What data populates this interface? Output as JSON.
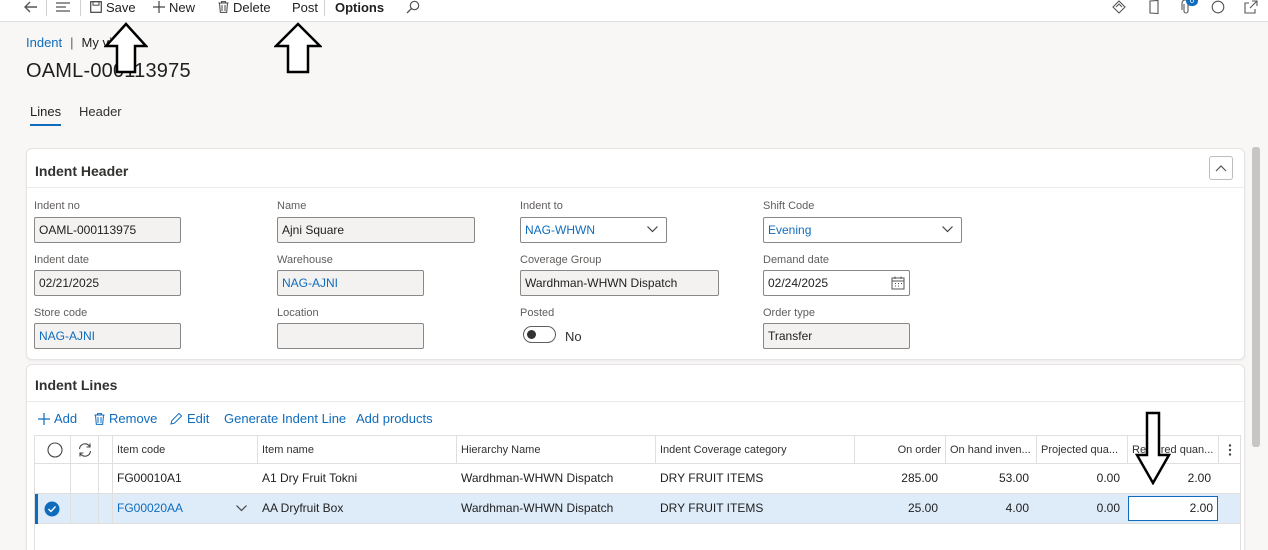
{
  "toolbar": {
    "save_label": "Save",
    "new_label": "New",
    "delete_label": "Delete",
    "post_label": "Post",
    "options_label": "Options",
    "notification_count": "0"
  },
  "breadcrumb": {
    "link": "Indent",
    "separator": "|",
    "view": "My view"
  },
  "page_title": "OAML-000113975",
  "tabs": [
    {
      "label": "Lines",
      "active": true
    },
    {
      "label": "Header",
      "active": false
    }
  ],
  "indent_header": {
    "title": "Indent Header",
    "fields": {
      "indent_no": {
        "label": "Indent no",
        "value": "OAML-000113975"
      },
      "name": {
        "label": "Name",
        "value": "Ajni Square"
      },
      "indent_to": {
        "label": "Indent to",
        "value": "NAG-WHWN"
      },
      "shift_code": {
        "label": "Shift Code",
        "value": "Evening"
      },
      "indent_date": {
        "label": "Indent date",
        "value": "02/21/2025"
      },
      "warehouse": {
        "label": "Warehouse",
        "value": "NAG-AJNI"
      },
      "coverage_group": {
        "label": "Coverage Group",
        "value": "Wardhman-WHWN Dispatch"
      },
      "demand_date": {
        "label": "Demand date",
        "value": "02/24/2025"
      },
      "store_code": {
        "label": "Store code",
        "value": "NAG-AJNI"
      },
      "location": {
        "label": "Location",
        "value": ""
      },
      "posted": {
        "label": "Posted",
        "value": "No"
      },
      "order_type": {
        "label": "Order type",
        "value": "Transfer"
      }
    }
  },
  "indent_lines": {
    "title": "Indent Lines",
    "actions": {
      "add": "Add",
      "remove": "Remove",
      "edit": "Edit",
      "generate": "Generate Indent Line",
      "add_products": "Add products"
    },
    "columns": [
      "Item code",
      "Item name",
      "Hierarchy Name",
      "Indent Coverage category",
      "On order",
      "On hand inven...",
      "Projected qua...",
      "Required quan..."
    ],
    "rows": [
      {
        "item_code": "FG00010A1",
        "item_name": "A1 Dry Fruit Tokni",
        "hierarchy": "Wardhman-WHWN Dispatch",
        "category": "DRY FRUIT ITEMS",
        "on_order": "285.00",
        "on_hand": "53.00",
        "projected": "0.00",
        "required": "2.00",
        "selected": false
      },
      {
        "item_code": "FG00020AA",
        "item_name": "AA Dryfruit Box",
        "hierarchy": "Wardhman-WHWN Dispatch",
        "category": "DRY FRUIT ITEMS",
        "on_order": "25.00",
        "on_hand": "4.00",
        "projected": "0.00",
        "required": "2.00",
        "selected": true
      }
    ]
  },
  "colors": {
    "accent": "#0f6cbd",
    "selected_row": "#deecf9"
  }
}
